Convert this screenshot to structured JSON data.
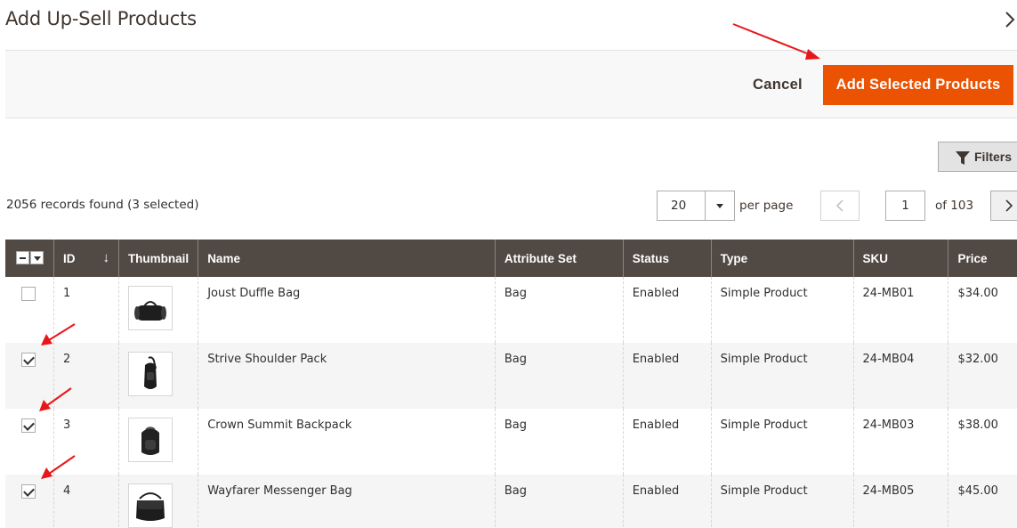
{
  "modal": {
    "title": "Add Up-Sell Products",
    "close_icon": "chevron-right-icon"
  },
  "actions": {
    "cancel_label": "Cancel",
    "add_label": "Add Selected Products",
    "accent_color": "#eb5202"
  },
  "toolbar": {
    "filters_label": "Filters",
    "filters_icon": "funnel-icon",
    "records_text": "2056 records found (3 selected)",
    "per_page_value": "20",
    "per_page_label": "per page",
    "current_page": "1",
    "of_pages": "of 103"
  },
  "grid": {
    "header_color": "#514943",
    "columns": {
      "id": "ID",
      "thumbnail": "Thumbnail",
      "name": "Name",
      "attribute_set": "Attribute Set",
      "status": "Status",
      "type": "Type",
      "sku": "SKU",
      "price": "Price"
    },
    "sort_indicator": "↓",
    "rows": [
      {
        "id": "1",
        "name": "Joust Duffle Bag",
        "attribute_set": "Bag",
        "status": "Enabled",
        "type": "Simple Product",
        "sku": "24-MB01",
        "price": "$34.00",
        "checked": false,
        "thumb_icon": "duffle-bag-icon"
      },
      {
        "id": "2",
        "name": "Strive Shoulder Pack",
        "attribute_set": "Bag",
        "status": "Enabled",
        "type": "Simple Product",
        "sku": "24-MB04",
        "price": "$32.00",
        "checked": true,
        "thumb_icon": "shoulder-pack-icon"
      },
      {
        "id": "3",
        "name": "Crown Summit Backpack",
        "attribute_set": "Bag",
        "status": "Enabled",
        "type": "Simple Product",
        "sku": "24-MB03",
        "price": "$38.00",
        "checked": true,
        "thumb_icon": "backpack-icon"
      },
      {
        "id": "4",
        "name": "Wayfarer Messenger Bag",
        "attribute_set": "Bag",
        "status": "Enabled",
        "type": "Simple Product",
        "sku": "24-MB05",
        "price": "$45.00",
        "checked": true,
        "thumb_icon": "messenger-bag-icon"
      }
    ]
  },
  "annotations": {
    "arrow_color": "#e8161b"
  }
}
